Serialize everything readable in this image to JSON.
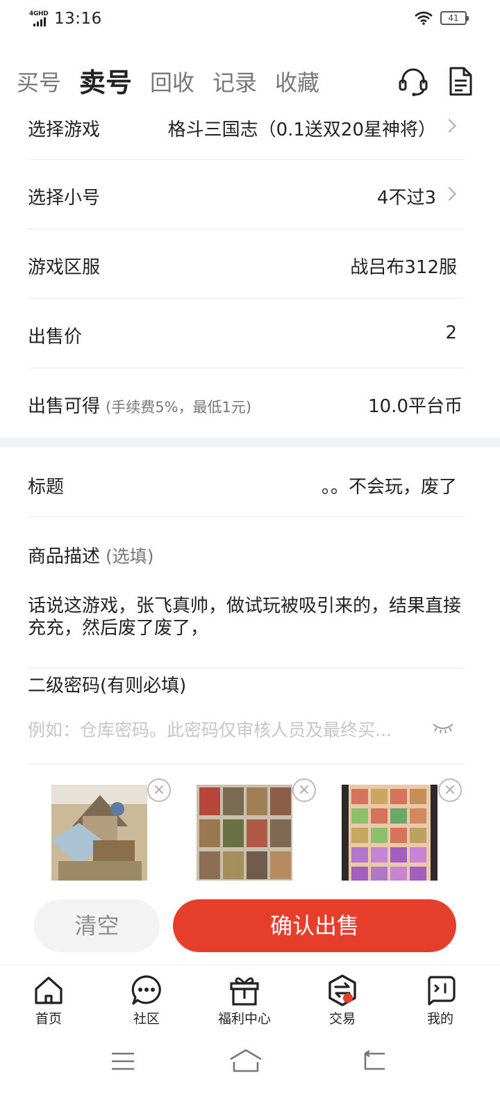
{
  "status": {
    "network": "4GHD",
    "time": "13:16",
    "battery": "41"
  },
  "tabs": [
    {
      "label": "买号",
      "active": false
    },
    {
      "label": "卖号",
      "active": true
    },
    {
      "label": "回收",
      "active": false
    },
    {
      "label": "记录",
      "active": false
    },
    {
      "label": "收藏",
      "active": false
    }
  ],
  "header_icons": [
    "headset-icon",
    "document-icon"
  ],
  "form": {
    "game": {
      "label": "选择游戏",
      "value": "格斗三国志（0.1送双20星神将）"
    },
    "sub_account": {
      "label": "选择小号",
      "value": "4不过3"
    },
    "server": {
      "label": "游戏区服",
      "value": "战吕布312服"
    },
    "price": {
      "label": "出售价",
      "value": "2"
    },
    "earnings": {
      "label": "出售可得",
      "hint": "(手续费5%，最低1元)",
      "value": "10.0平台币"
    },
    "title": {
      "label": "标题",
      "value": "。。不会玩，废了"
    },
    "description": {
      "label": "商品描述",
      "hint": "(选填)",
      "value": "话说这游戏，张飞真帅，做试玩被吸引来的，结果直接充充，然后废了废了，"
    },
    "password": {
      "label": "二级密码(有则必填)",
      "placeholder": "例如：仓库密码。此密码仅审核人员及最终买..."
    }
  },
  "thumb_close_glyph": "×",
  "actions": {
    "clear": "清空",
    "confirm": "确认出售"
  },
  "colors": {
    "accent": "#e53e2b",
    "band": "#f0f2f7"
  },
  "bottom_nav": [
    {
      "label": "首页",
      "icon": "home-icon"
    },
    {
      "label": "社区",
      "icon": "chat-bubble-icon"
    },
    {
      "label": "福利中心",
      "icon": "gift-icon"
    },
    {
      "label": "交易",
      "icon": "trade-icon"
    },
    {
      "label": "我的",
      "icon": "profile-icon"
    }
  ],
  "system_nav": [
    "menu-icon",
    "home-icon",
    "back-icon"
  ]
}
